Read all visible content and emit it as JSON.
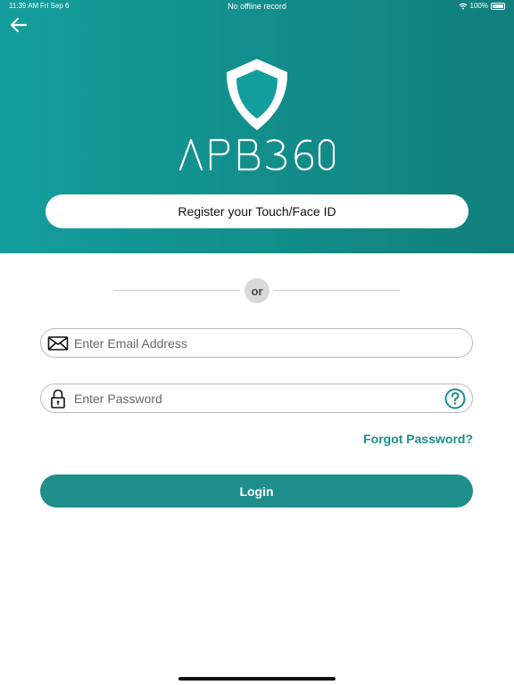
{
  "status_bar": {
    "time": "11:39 AM",
    "date": "Fri Sep 6",
    "center_text": "No offline record",
    "battery": "100%",
    "icons": [
      "wifi-icon",
      "battery-icon"
    ]
  },
  "header": {
    "back_icon": "arrow-left-icon",
    "logo_text": "APB360",
    "touch_id_label": "Register your Touch/Face ID"
  },
  "divider": {
    "label": "or"
  },
  "form": {
    "email": {
      "placeholder": "Enter Email Address",
      "value": "",
      "icon": "envelope-icon"
    },
    "password": {
      "placeholder": "Enter Password",
      "value": "",
      "icon": "lock-icon",
      "help_icon": "question-circle-icon"
    },
    "forgot_label": "Forgot Password?",
    "login_label": "Login"
  },
  "colors": {
    "brand_teal": "#1f8f8c",
    "header_gradient_start": "#139e9d",
    "header_gradient_end": "#117f7b",
    "link_teal": "#1a8d8a"
  }
}
